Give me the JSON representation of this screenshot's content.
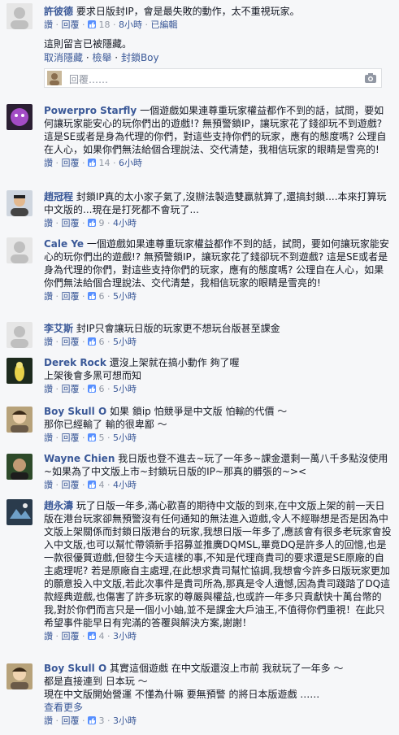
{
  "comments": [
    {
      "name": "許彼德",
      "text": "要求日版封IP，會是最失敗的動作，太不重視玩家。",
      "like_label": "讚",
      "reply_label": "回覆",
      "likes": "18",
      "time": "8小時",
      "edited": "已編輯",
      "hidden_notice": "這則留言已被隱藏。",
      "actions": [
        "取消隱藏",
        "檢舉",
        "封鎖Boy"
      ],
      "reply_placeholder": "回覆……"
    },
    {
      "name": "Powerpro Starfly",
      "text": "一個遊戲如果連尊重玩家權益都作不到的話，試問，要如何讓玩家能安心的玩你們出的遊戲!? 無預警鎖IP，讓玩家花了錢卻玩不到遊戲? 這是SE或者是身為代理的你們，對這些支持你們的玩家，應有的態度嗎? 公理自在人心，如果你們無法給個合理說法、交代清楚，我相信玩家的眼睛是雪亮的!",
      "like_label": "讚",
      "reply_label": "回覆",
      "likes": "14",
      "time": "6小時"
    },
    {
      "name": "趙冠程",
      "text": "封鎖IP真的太小家子氣了,沒辦法製造雙贏就算了,還搞封鎖....本來打算玩中文版的...現在是打死都不會玩了...",
      "like_label": "讚",
      "reply_label": "回覆",
      "likes": "9",
      "time": "4小時"
    },
    {
      "name": "Cale Ye",
      "text": "一個遊戲如果連尊重玩家權益都作不到的話，試問，要如何讓玩家能安心的玩你們出的遊戲!? 無預警鎖IP，讓玩家花了錢卻玩不到遊戲? 這是SE或者是身為代理的你們，對這些支持你們的玩家，應有的態度嗎? 公理自在人心，如果你們無法給個合理說法、交代清楚，我相信玩家的眼睛是雪亮的!",
      "like_label": "讚",
      "reply_label": "回覆",
      "likes": "6",
      "time": "5小時"
    },
    {
      "name": "李艾斯",
      "text": "封IP只會讓玩日版的玩家更不想玩台版甚至課金",
      "like_label": "讚",
      "reply_label": "回覆",
      "likes": "6",
      "time": "5小時"
    },
    {
      "name": "Derek Rock",
      "text": "還沒上架就在搞小動作 夠了喔",
      "text2": "上架後會多黑可想而知",
      "like_label": "讚",
      "reply_label": "回覆",
      "likes": "6",
      "time": "5小時"
    },
    {
      "name": "Boy Skull O",
      "text": "如果 鎖ip 怕競爭是中文版 怕輸的代價 ～",
      "text2": "那你已經輸了 輸的很卑鄙 ～",
      "like_label": "讚",
      "reply_label": "回覆",
      "likes": "5",
      "time": "5小時"
    },
    {
      "name": "Wayne Chien",
      "text": "我日版也登不進去~玩了一年多~課金還剩一萬八千多點沒使用~如果為了中文版上市~封鎖玩日版的IP~那真的髒張的~>< ",
      "like_label": "讚",
      "reply_label": "回覆",
      "likes": "4",
      "time": "4小時"
    },
    {
      "name": "趙永濤",
      "text": "玩了日版一年多,滿心歡喜的期待中文版的到來,在中文版上架的前一天日版在港台玩家卻無預警沒有任何通知的無法進入遊戲,令人不經聯想是否是因為中文版上架關係而封鎖日版港台的玩家,我想日版一年多了,應該會有很多老玩家會投入中文版,也可以幫忙帶領新手招募並推廣DQMSL,畢竟DQ是許多人的回憶,也是一款很優質遊戲,但發生今天這樣的事,不知是代理商貴司的要求還是SE原廠的自主處理呢? 若是原廠自主處理,在此想求貴司幫忙協調,我想會今許多日版玩家更加的願意投入中文版,若此次事件是貴司所為,那真是令人遺憾,因為貴司踐踏了DQ這款經典遊戲,也傷害了許多玩家的尊嚴與權益,也或許一年多只貢獻快十萬台幣的我,對於你們而言只是一個小小蚰,並不是課金大戶油王,不值得你們重視！在此只希望事件能早日有完滿的答覆與解決方案,謝謝！",
      "like_label": "讚",
      "reply_label": "回覆",
      "likes": "4",
      "time": "3小時"
    },
    {
      "name": "Boy Skull O",
      "text": "其實這個遊戲 在中文版還沒上市前 我就玩了一年多 ～",
      "text2": "都是直接連到 日本玩 ～",
      "text3": "現在中文版開始營運 不懂為什嘛 要無預警 的將日本版遊戲 ……",
      "see_more": "查看更多",
      "like_label": "讚",
      "reply_label": "回覆",
      "likes": "3",
      "time": "3小時"
    }
  ],
  "colors": {
    "link": "#3b5998",
    "meta": "#9197a3",
    "bg": "#f6f7f9"
  }
}
